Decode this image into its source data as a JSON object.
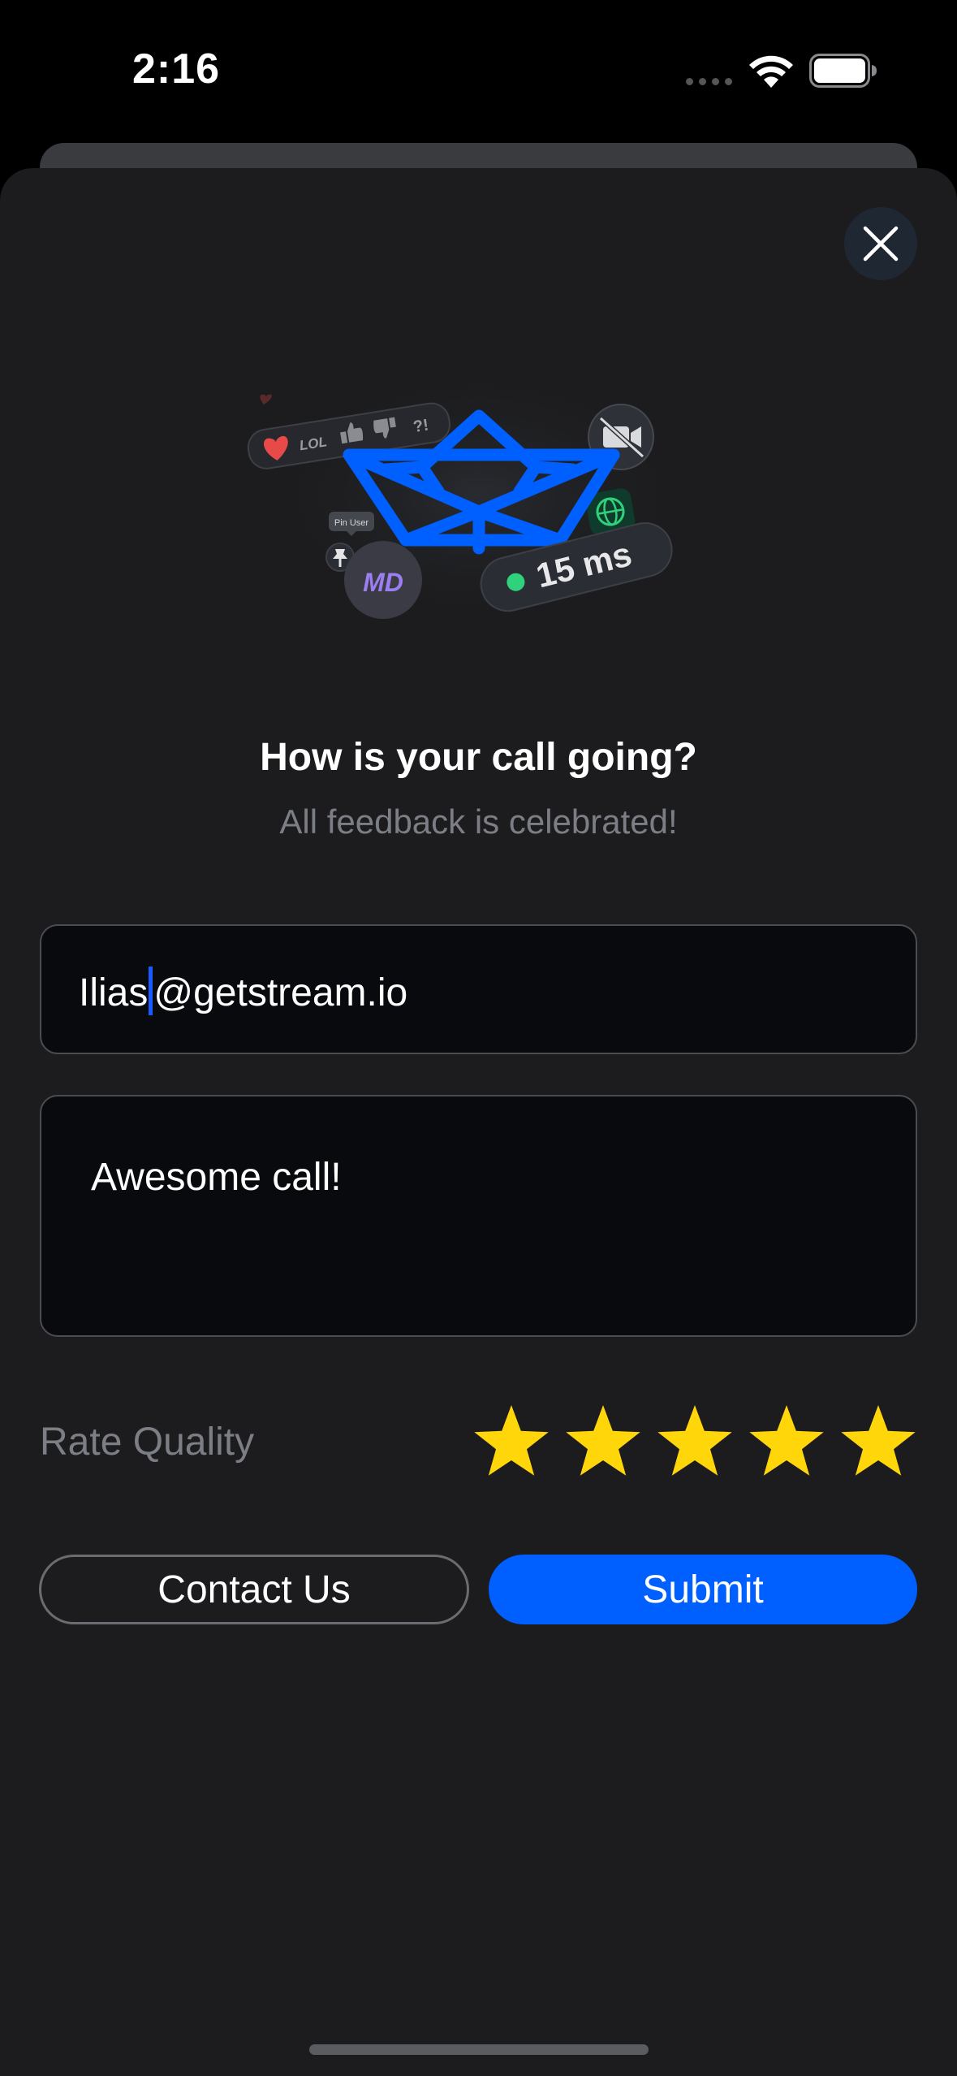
{
  "status_bar": {
    "time": "2:16"
  },
  "illustration": {
    "reactions": [
      "LOL",
      "?!"
    ],
    "pin_label": "Pin User",
    "avatar_initials": "MD",
    "latency": "15 ms"
  },
  "feedback": {
    "title": "How is your call going?",
    "subtitle": "All feedback is celebrated!",
    "email_value_before_caret": "Ilias",
    "email_value_after_caret": "@getstream.io",
    "comment_value": "Awesome call!",
    "rate_label": "Rate Quality",
    "rating": 5,
    "max_rating": 5,
    "contact_label": "Contact Us",
    "submit_label": "Submit"
  },
  "colors": {
    "accent": "#005fff",
    "star": "#ffd60a",
    "sheet_bg": "#1c1c1e",
    "field_bg": "#080a0d",
    "online_dot": "#2fd17a"
  },
  "icons": [
    "close-icon",
    "wifi-icon",
    "battery-icon",
    "star-icon",
    "paper-boat-icon",
    "globe-icon",
    "camera-off-icon",
    "pin-icon",
    "heart-icon",
    "thumbs-up-icon",
    "thumbs-down-icon"
  ]
}
